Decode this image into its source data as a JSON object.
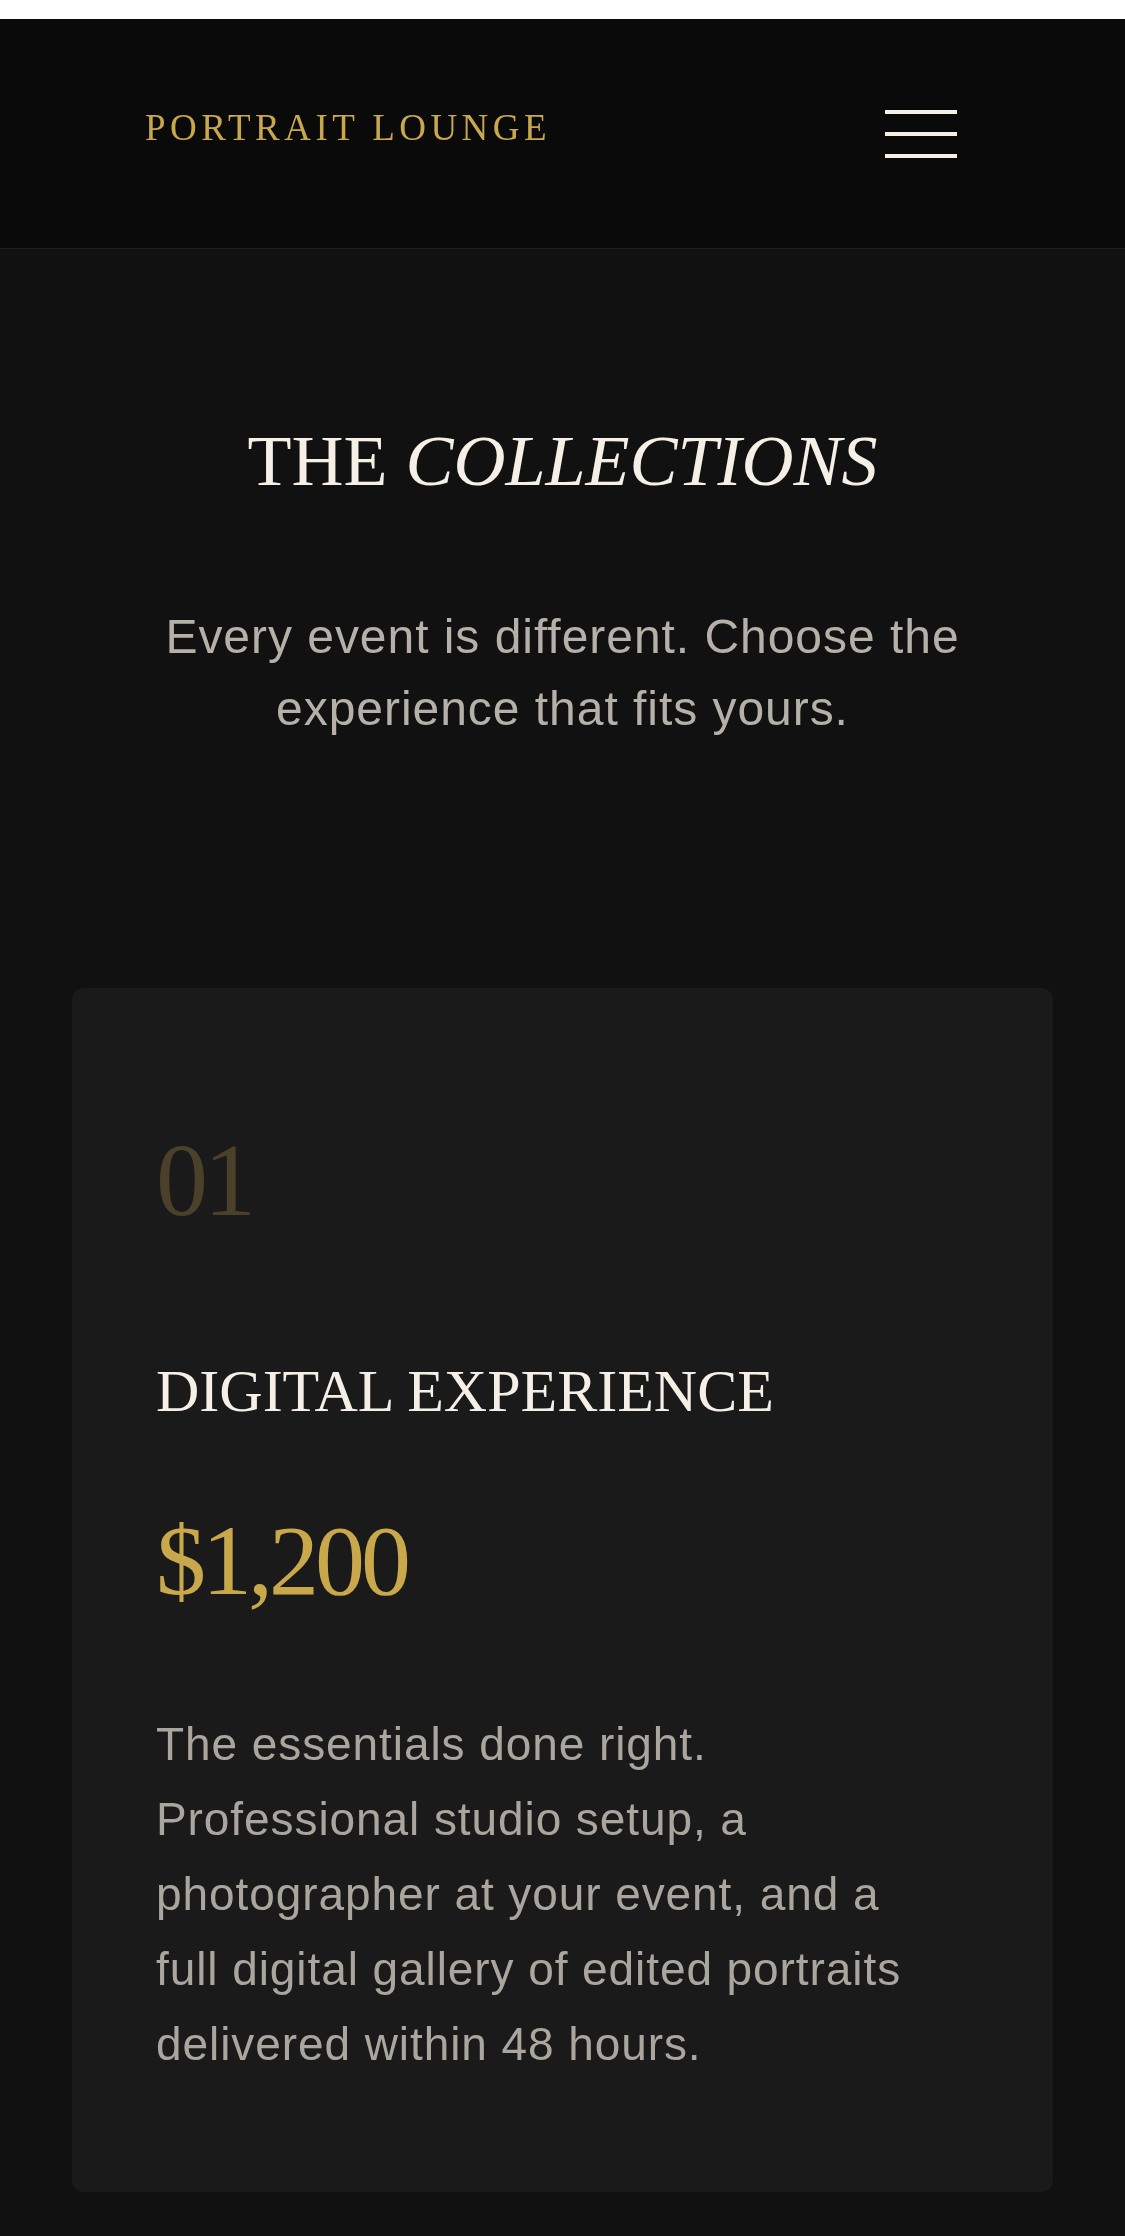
{
  "header": {
    "logo": "PORTRAIT LOUNGE"
  },
  "hero": {
    "title": "THE *COLLECTIONS*",
    "subtitle": "Every event is different. Choose the experience that fits yours."
  },
  "collections": [
    {
      "number": "01",
      "name": "DIGITAL EXPERIENCE",
      "price": "$1,200",
      "description": "The essentials done right. Professional studio setup, a photographer at your event, and a full digital gallery of edited portraits delivered within 48 hours."
    }
  ]
}
